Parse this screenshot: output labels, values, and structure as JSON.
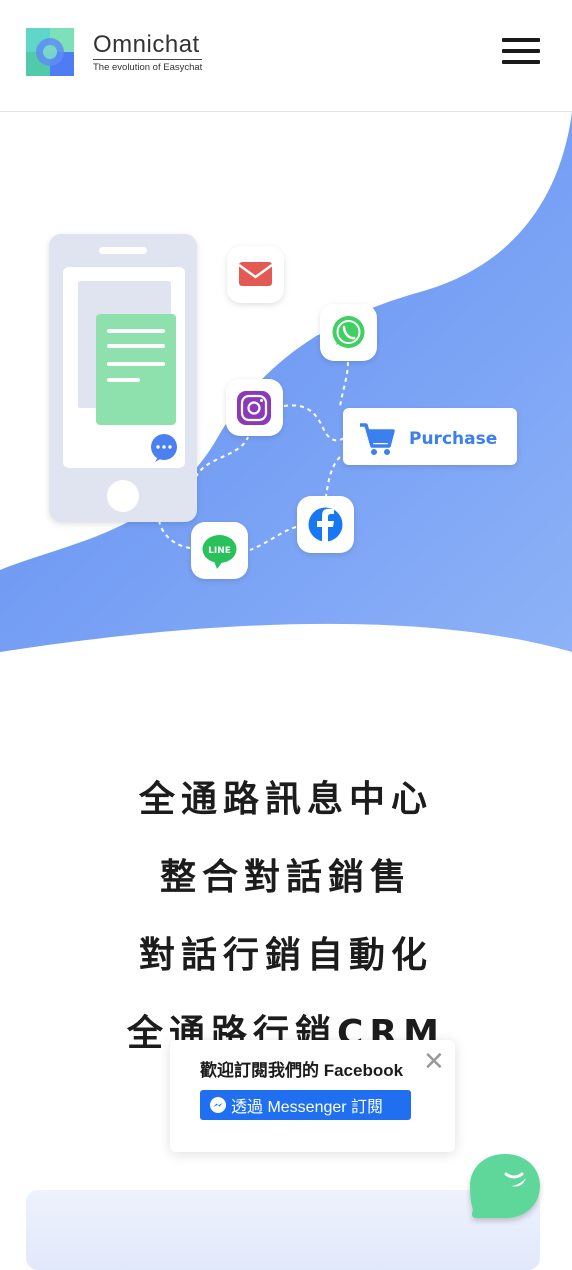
{
  "header": {
    "brand_name": "Omnichat",
    "brand_tagline": "The evolution of Easychat",
    "menu_icon": "hamburger-icon"
  },
  "hero": {
    "purchase_label": "Purchase",
    "line_label": "LINE",
    "channels": [
      "email-icon",
      "whatsapp-icon",
      "instagram-icon",
      "facebook-icon",
      "line-icon",
      "cart-icon"
    ],
    "colors": {
      "blue_wave": "#6f9bf3",
      "email": "#e35a54",
      "whatsapp": "#3fcf63",
      "instagram": "#8a3ab9",
      "facebook": "#1877f2",
      "line": "#27c25a",
      "purchase": "#3b7ff0"
    }
  },
  "headlines": [
    "全通路訊息中心",
    "整合對話銷售",
    "對話行銷自動化",
    "全通路行銷CRM"
  ],
  "facebook_popup": {
    "title": "歡迎訂閱我們的 Facebook",
    "button_label": "透過 Messenger 訂閱",
    "close_icon": "close-icon"
  },
  "chat_widget": {
    "icon": "chat-bubble-icon",
    "color": "#5ed69a"
  }
}
